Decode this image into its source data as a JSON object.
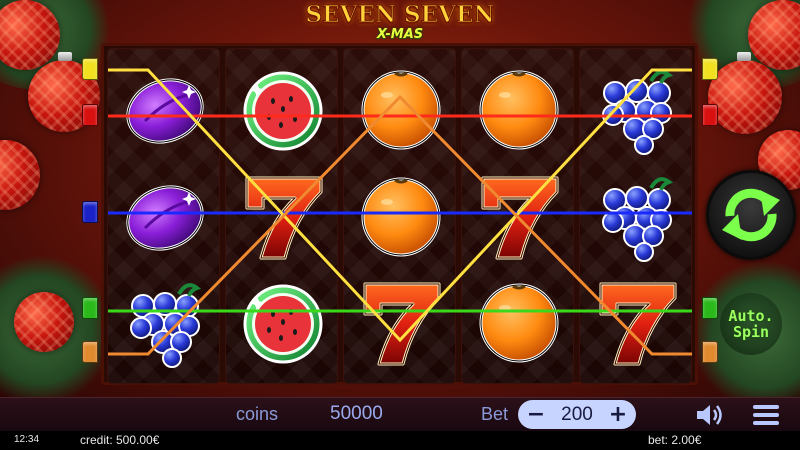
{
  "title": {
    "line1": "SEVEN SEVEN",
    "line2": "X-MAS"
  },
  "reels": [
    [
      "plum",
      "plum",
      "grapes"
    ],
    [
      "watermelon",
      "seven",
      "watermelon"
    ],
    [
      "orange",
      "orange",
      "seven"
    ],
    [
      "orange",
      "seven",
      "orange"
    ],
    [
      "grapes",
      "grapes",
      "seven"
    ]
  ],
  "paylines": [
    {
      "color": "#ff2a1a"
    },
    {
      "color": "#1a2aff"
    },
    {
      "color": "#3ad81a"
    },
    {
      "color": "#ffe040"
    },
    {
      "color": "#f08a30"
    }
  ],
  "controls": {
    "auto_spin_line1": "Auto.",
    "auto_spin_line2": "Spin"
  },
  "bottom_bar": {
    "coins_label": "coins",
    "coins_value": "50000",
    "bet_label": "Bet",
    "bet_value": "200",
    "minus": "−",
    "plus": "+"
  },
  "status_bar": {
    "clock": "12:34",
    "credit": "credit: 500.00€",
    "bet": "bet: 2.00€"
  },
  "colors": {
    "spin_green": "#7cff4a",
    "bet_pill": "#c7d4ff"
  }
}
